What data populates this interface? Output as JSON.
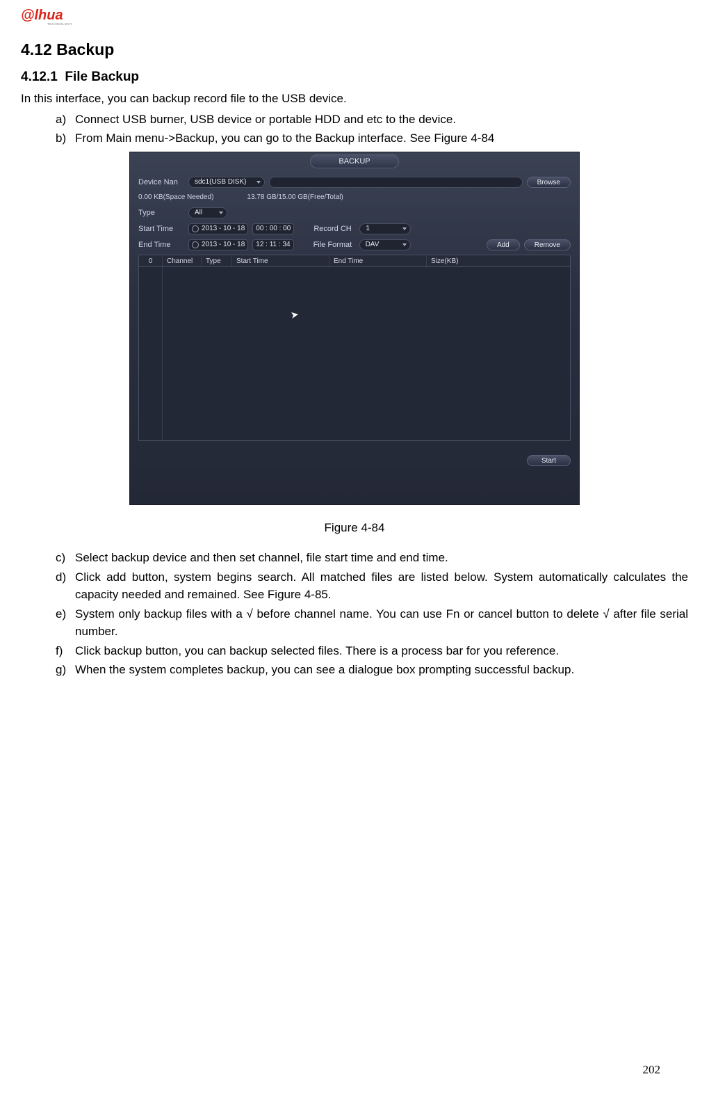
{
  "logo": {
    "brand": "alhua",
    "subtext": "TECHNOLOGY"
  },
  "section": {
    "number": "4.12",
    "title": "Backup"
  },
  "subsection": {
    "number": "4.12.1",
    "title": "File Backup"
  },
  "intro": "In this interface, you can backup record file to the USB device.",
  "steps_ab": [
    {
      "letter": "a)",
      "text": "Connect USB burner, USB device or portable HDD and etc to the device."
    },
    {
      "letter": "b)",
      "text": "From Main menu->Backup, you can go to the Backup interface. See Figure 4-84"
    }
  ],
  "screenshot": {
    "header": "BACKUP",
    "labels": {
      "device_name": "Device Nan",
      "type": "Type",
      "start_time": "Start Time",
      "end_time": "End Time",
      "record_ch": "Record CH",
      "file_format": "File Format"
    },
    "values": {
      "device_name": "sdc1(USB DISK)",
      "path": "",
      "space_needed": "0.00 KB(Space Needed)",
      "free_total": "13.78 GB/15.00 GB(Free/Total)",
      "type": "All",
      "start_date": "2013 - 10 - 18",
      "start_clock": "00 : 00 : 00",
      "end_date": "2013 - 10 - 18",
      "end_clock": "12 : 11 : 34",
      "record_ch": "1",
      "file_format": "DAV"
    },
    "buttons": {
      "browse": "Browse",
      "add": "Add",
      "remove": "Remove",
      "start": "Start"
    },
    "table": {
      "count": "0",
      "cols": [
        "Channel",
        "Type",
        "Start Time",
        "End Time",
        "Size(KB)"
      ]
    }
  },
  "figure_caption": "Figure 4-84",
  "steps_cg": [
    {
      "letter": "c)",
      "text": "Select backup device and then set channel, file start time and end time."
    },
    {
      "letter": "d)",
      "text": "Click add button, system begins search. All matched files are listed below. System automatically calculates the capacity needed and remained. See Figure 4-85."
    },
    {
      "letter": "e)",
      "text": "System only backup files with a   √ before channel name. You can use Fn or cancel button to delete √ after file serial number."
    },
    {
      "letter": "f)",
      "text": "Click backup button, you can backup selected files. There is a process bar for you reference."
    },
    {
      "letter": "g)",
      "text": "When the system completes backup, you can see a dialogue box prompting successful backup."
    }
  ],
  "page_number": "202"
}
